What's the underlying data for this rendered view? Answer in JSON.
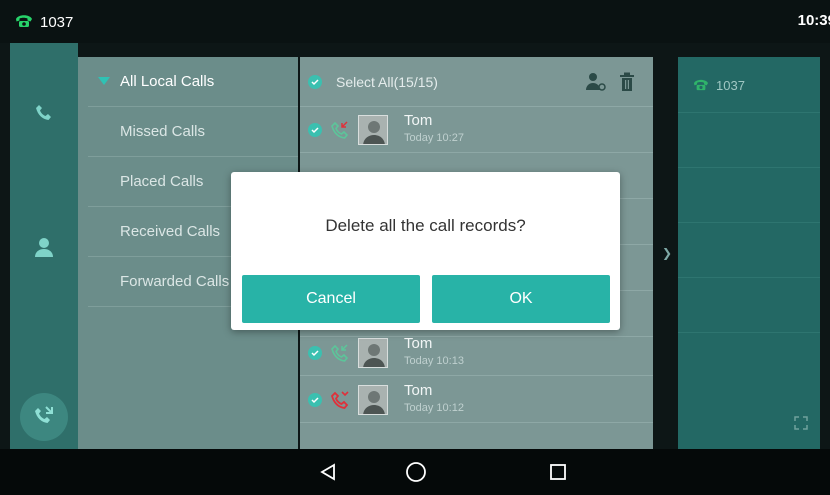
{
  "statusbar": {
    "extension": "1037",
    "time": "10:39"
  },
  "menu": {
    "items": [
      {
        "label": "All Local Calls",
        "active": true
      },
      {
        "label": "Missed Calls",
        "active": false
      },
      {
        "label": "Placed Calls",
        "active": false
      },
      {
        "label": "Received Calls",
        "active": false
      },
      {
        "label": "Forwarded Calls",
        "active": false
      }
    ]
  },
  "list": {
    "select_all_label": "Select All(15/15)",
    "rows": [
      {
        "name": "Tom",
        "time": "Today 10:27",
        "call_type": "received"
      },
      {
        "name": "Tom",
        "time": "Today 10:13",
        "call_type": "received"
      },
      {
        "name": "Tom",
        "time": "Today 10:12",
        "call_type": "missed"
      }
    ]
  },
  "right_panel": {
    "extension": "1037"
  },
  "dialog": {
    "message": "Delete all the call records?",
    "cancel_label": "Cancel",
    "ok_label": "OK"
  },
  "colors": {
    "accent": "#28b3a7",
    "missed": "#e0303a",
    "received": "#6ec9a0"
  },
  "icons": [
    "phone-icon",
    "contacts-icon",
    "history-icon",
    "user-icon",
    "trash-icon",
    "check-icon",
    "back-icon",
    "home-icon",
    "recents-icon",
    "expand-icon"
  ]
}
